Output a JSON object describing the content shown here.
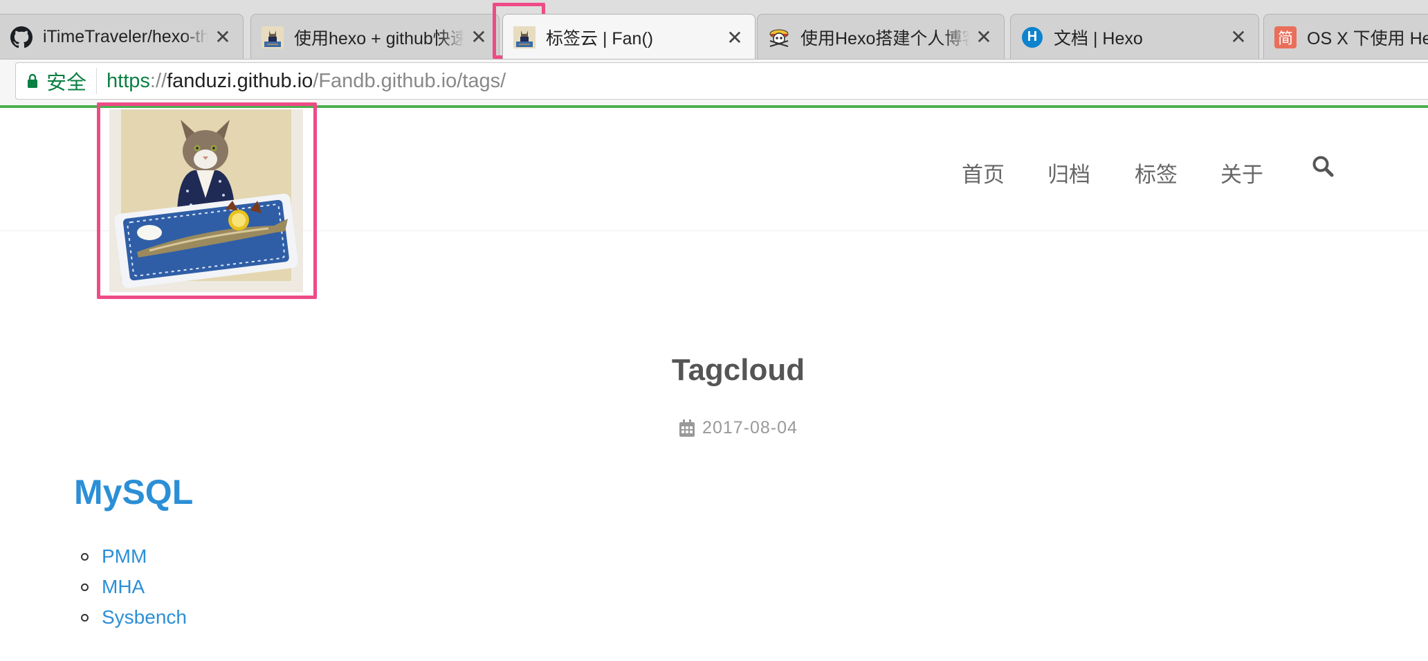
{
  "browser": {
    "tabs": [
      {
        "title": "iTimeTraveler/hexo-theme",
        "favicon": "github-icon",
        "active": false
      },
      {
        "title": "使用hexo + github快速",
        "favicon": "cat-avatar-icon",
        "active": false
      },
      {
        "title": "标签云 | Fan()",
        "favicon": "cat-avatar-icon",
        "active": true
      },
      {
        "title": "使用Hexo搭建个人博客",
        "favicon": "pirate-skull-icon",
        "active": false
      },
      {
        "title": "文档 | Hexo",
        "favicon": "hexo-icon",
        "active": false
      },
      {
        "title": "OS X 下使用 Hexo",
        "favicon": "jianshu-icon",
        "active": false
      }
    ],
    "close_glyph": "✕",
    "hexo_glyph": "H",
    "jianshu_glyph": "简",
    "security_label": "安全",
    "url": {
      "scheme": "https",
      "separator": "://",
      "host": "fanduzi.github.io",
      "path": "/Fandb.github.io/tags/"
    },
    "load_bar_color": "#4caf50"
  },
  "site": {
    "nav": [
      {
        "label": "首页"
      },
      {
        "label": "归档"
      },
      {
        "label": "标签"
      },
      {
        "label": "关于"
      }
    ],
    "search_icon": "search-icon",
    "logo": "cat-with-saury-photo"
  },
  "post": {
    "title": "Tagcloud",
    "date": "2017-08-04",
    "date_icon": "calendar-icon"
  },
  "tag_section": {
    "heading": "MySQL",
    "items": [
      "PMM",
      "MHA",
      "Sysbench"
    ]
  },
  "colors": {
    "link": "#2b8fd6",
    "annotation": "#ee4b86"
  }
}
